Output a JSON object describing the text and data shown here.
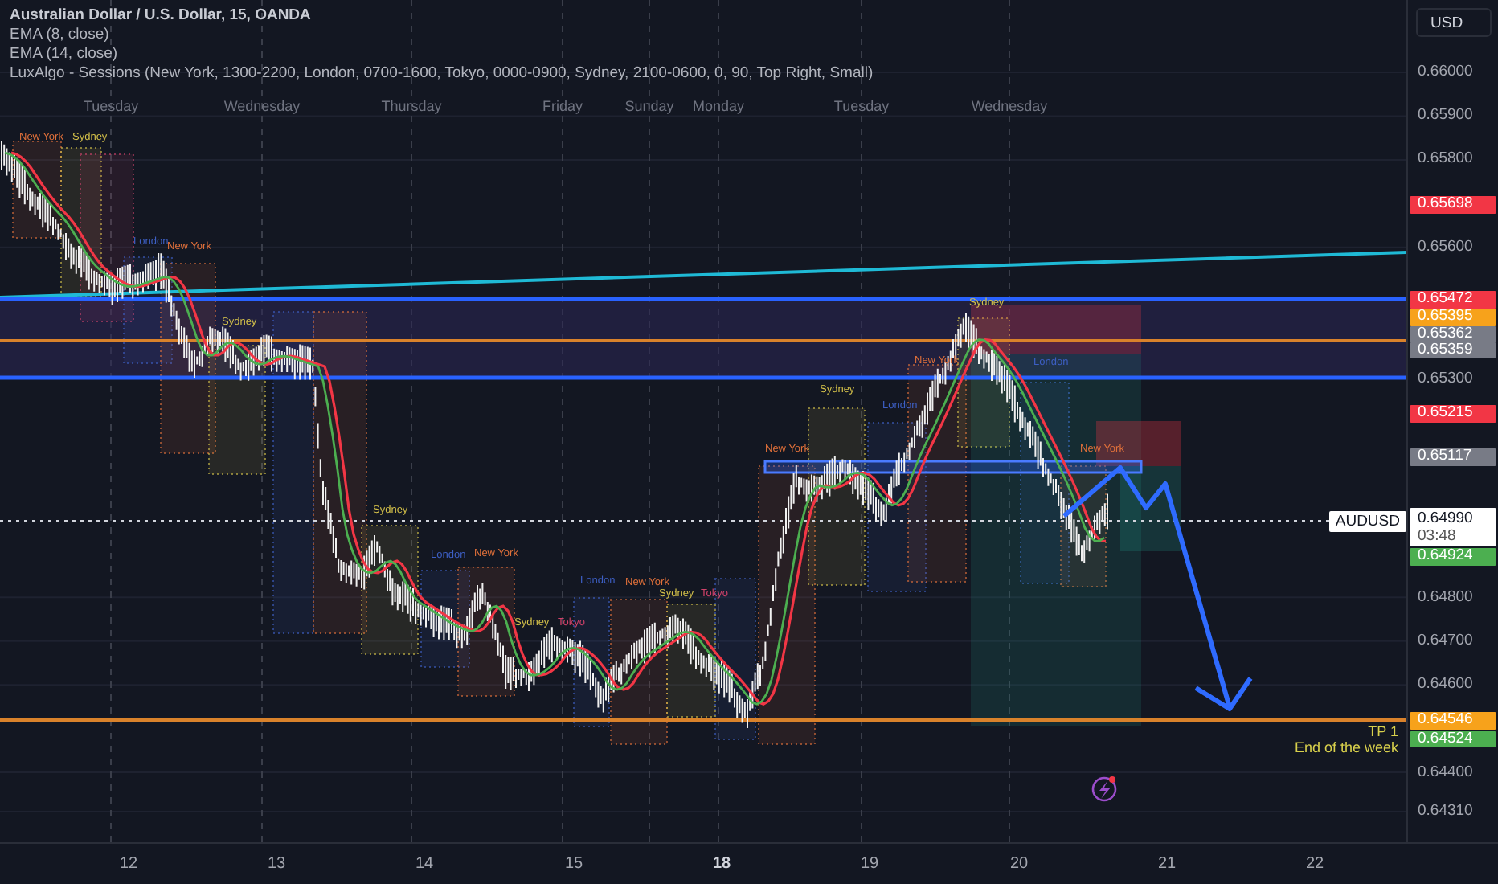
{
  "legend": {
    "title": "Australian Dollar / U.S. Dollar, 15, OANDA",
    "indicators": [
      "EMA (8, close)",
      "EMA (14, close)",
      "LuxAlgo - Sessions (New York, 1300-2200, London, 0700-1600, Tokyo, 0000-0900, Sydney, 2100-0600, 0, 90, Top Right, Small)"
    ]
  },
  "day_labels": [
    "Tuesday",
    "Wednesday",
    "Thursday",
    "Friday",
    "Sunday",
    "Monday",
    "Tuesday",
    "Wednesday"
  ],
  "sessions": [
    {
      "label": "New York",
      "color": "#e0703a"
    },
    {
      "label": "Sydney",
      "color": "#d4c14a"
    },
    {
      "label": "London",
      "color": "#3d5fc4"
    },
    {
      "label": "New York",
      "color": "#e0703a"
    },
    {
      "label": "Sydney",
      "color": "#d4c14a"
    },
    {
      "label": "Sydney",
      "color": "#d4c14a"
    },
    {
      "label": "London",
      "color": "#3d5fc4"
    },
    {
      "label": "New York",
      "color": "#e0703a"
    },
    {
      "label": "Sydney",
      "color": "#d4c14a"
    },
    {
      "label": "Tokyo",
      "color": "#d0426a"
    },
    {
      "label": "London",
      "color": "#3d5fc4"
    },
    {
      "label": "New York",
      "color": "#e0703a"
    },
    {
      "label": "Sydney",
      "color": "#d4c14a"
    },
    {
      "label": "Tokyo",
      "color": "#d0426a"
    },
    {
      "label": "New York",
      "color": "#e0703a"
    },
    {
      "label": "Sydney",
      "color": "#d4c14a"
    },
    {
      "label": "London",
      "color": "#3d5fc4"
    },
    {
      "label": "New York",
      "color": "#e0703a"
    },
    {
      "label": "Sydney",
      "color": "#d4c14a"
    },
    {
      "label": "London",
      "color": "#3d5fc4"
    },
    {
      "label": "New York",
      "color": "#e0703a"
    }
  ],
  "annotations": [
    "TP 1",
    "End of the week"
  ],
  "currency_button": "USD",
  "price_scale": [
    "0.66000",
    "0.65900",
    "0.65800",
    "0.65600",
    "0.65300",
    "0.64800",
    "0.64700",
    "0.64600",
    "0.64400",
    "0.64310"
  ],
  "price_badges": [
    {
      "text": "0.65698",
      "color": "#f23645"
    },
    {
      "text": "0.65472",
      "color": "#f23645"
    },
    {
      "text": "0.65395",
      "color": "#f7a21b"
    },
    {
      "text": "0.65362",
      "color": "#787b86"
    },
    {
      "text": "0.65359",
      "color": "#787b86"
    },
    {
      "text": "0.65215",
      "color": "#f23645"
    },
    {
      "text": "0.65117",
      "color": "#787b86"
    },
    {
      "text": "0.64924",
      "color": "#4caf50"
    },
    {
      "text": "0.64546",
      "color": "#f7a21b"
    },
    {
      "text": "0.64524",
      "color": "#4caf50"
    }
  ],
  "last_price": {
    "symbol": "AUDUSD",
    "price": "0.64990",
    "countdown": "03:48"
  },
  "time_axis": [
    {
      "label": "12",
      "emphasized": false
    },
    {
      "label": "13",
      "emphasized": false
    },
    {
      "label": "14",
      "emphasized": false
    },
    {
      "label": "15",
      "emphasized": false
    },
    {
      "label": "18",
      "emphasized": true
    },
    {
      "label": "19",
      "emphasized": false
    },
    {
      "label": "20",
      "emphasized": false
    },
    {
      "label": "21",
      "emphasized": false
    },
    {
      "label": "22",
      "emphasized": false
    }
  ]
}
